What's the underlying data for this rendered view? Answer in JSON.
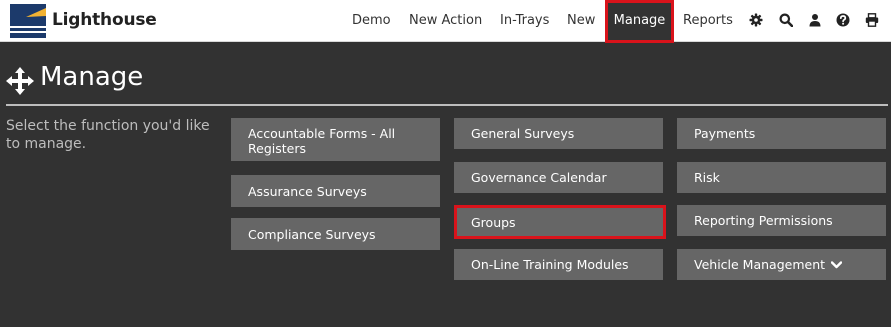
{
  "brand": {
    "name": "Lighthouse",
    "logo_icon": "lighthouse-logo-icon",
    "colors": {
      "navy": "#1c3a6b",
      "beam": "#f2b233"
    }
  },
  "nav": {
    "items": [
      "Demo",
      "New Action",
      "In-Trays",
      "New",
      "Manage",
      "Reports"
    ],
    "active": "Manage",
    "icons": [
      "gear-icon",
      "search-icon",
      "user-icon",
      "help-icon",
      "print-icon"
    ]
  },
  "page": {
    "title": "Manage",
    "title_icon": "move-arrows-icon",
    "intro": "Select the function you'd like to manage."
  },
  "tiles": {
    "col1": [
      "Accountable Forms - All Registers",
      "Assurance Surveys",
      "Compliance Surveys"
    ],
    "col2": [
      "General Surveys",
      "Governance Calendar",
      "Groups",
      "On-Line Training Modules"
    ],
    "col3": [
      "Payments",
      "Risk",
      "Reporting Permissions",
      "Vehicle Management"
    ]
  },
  "highlight_color": "#d9131b"
}
